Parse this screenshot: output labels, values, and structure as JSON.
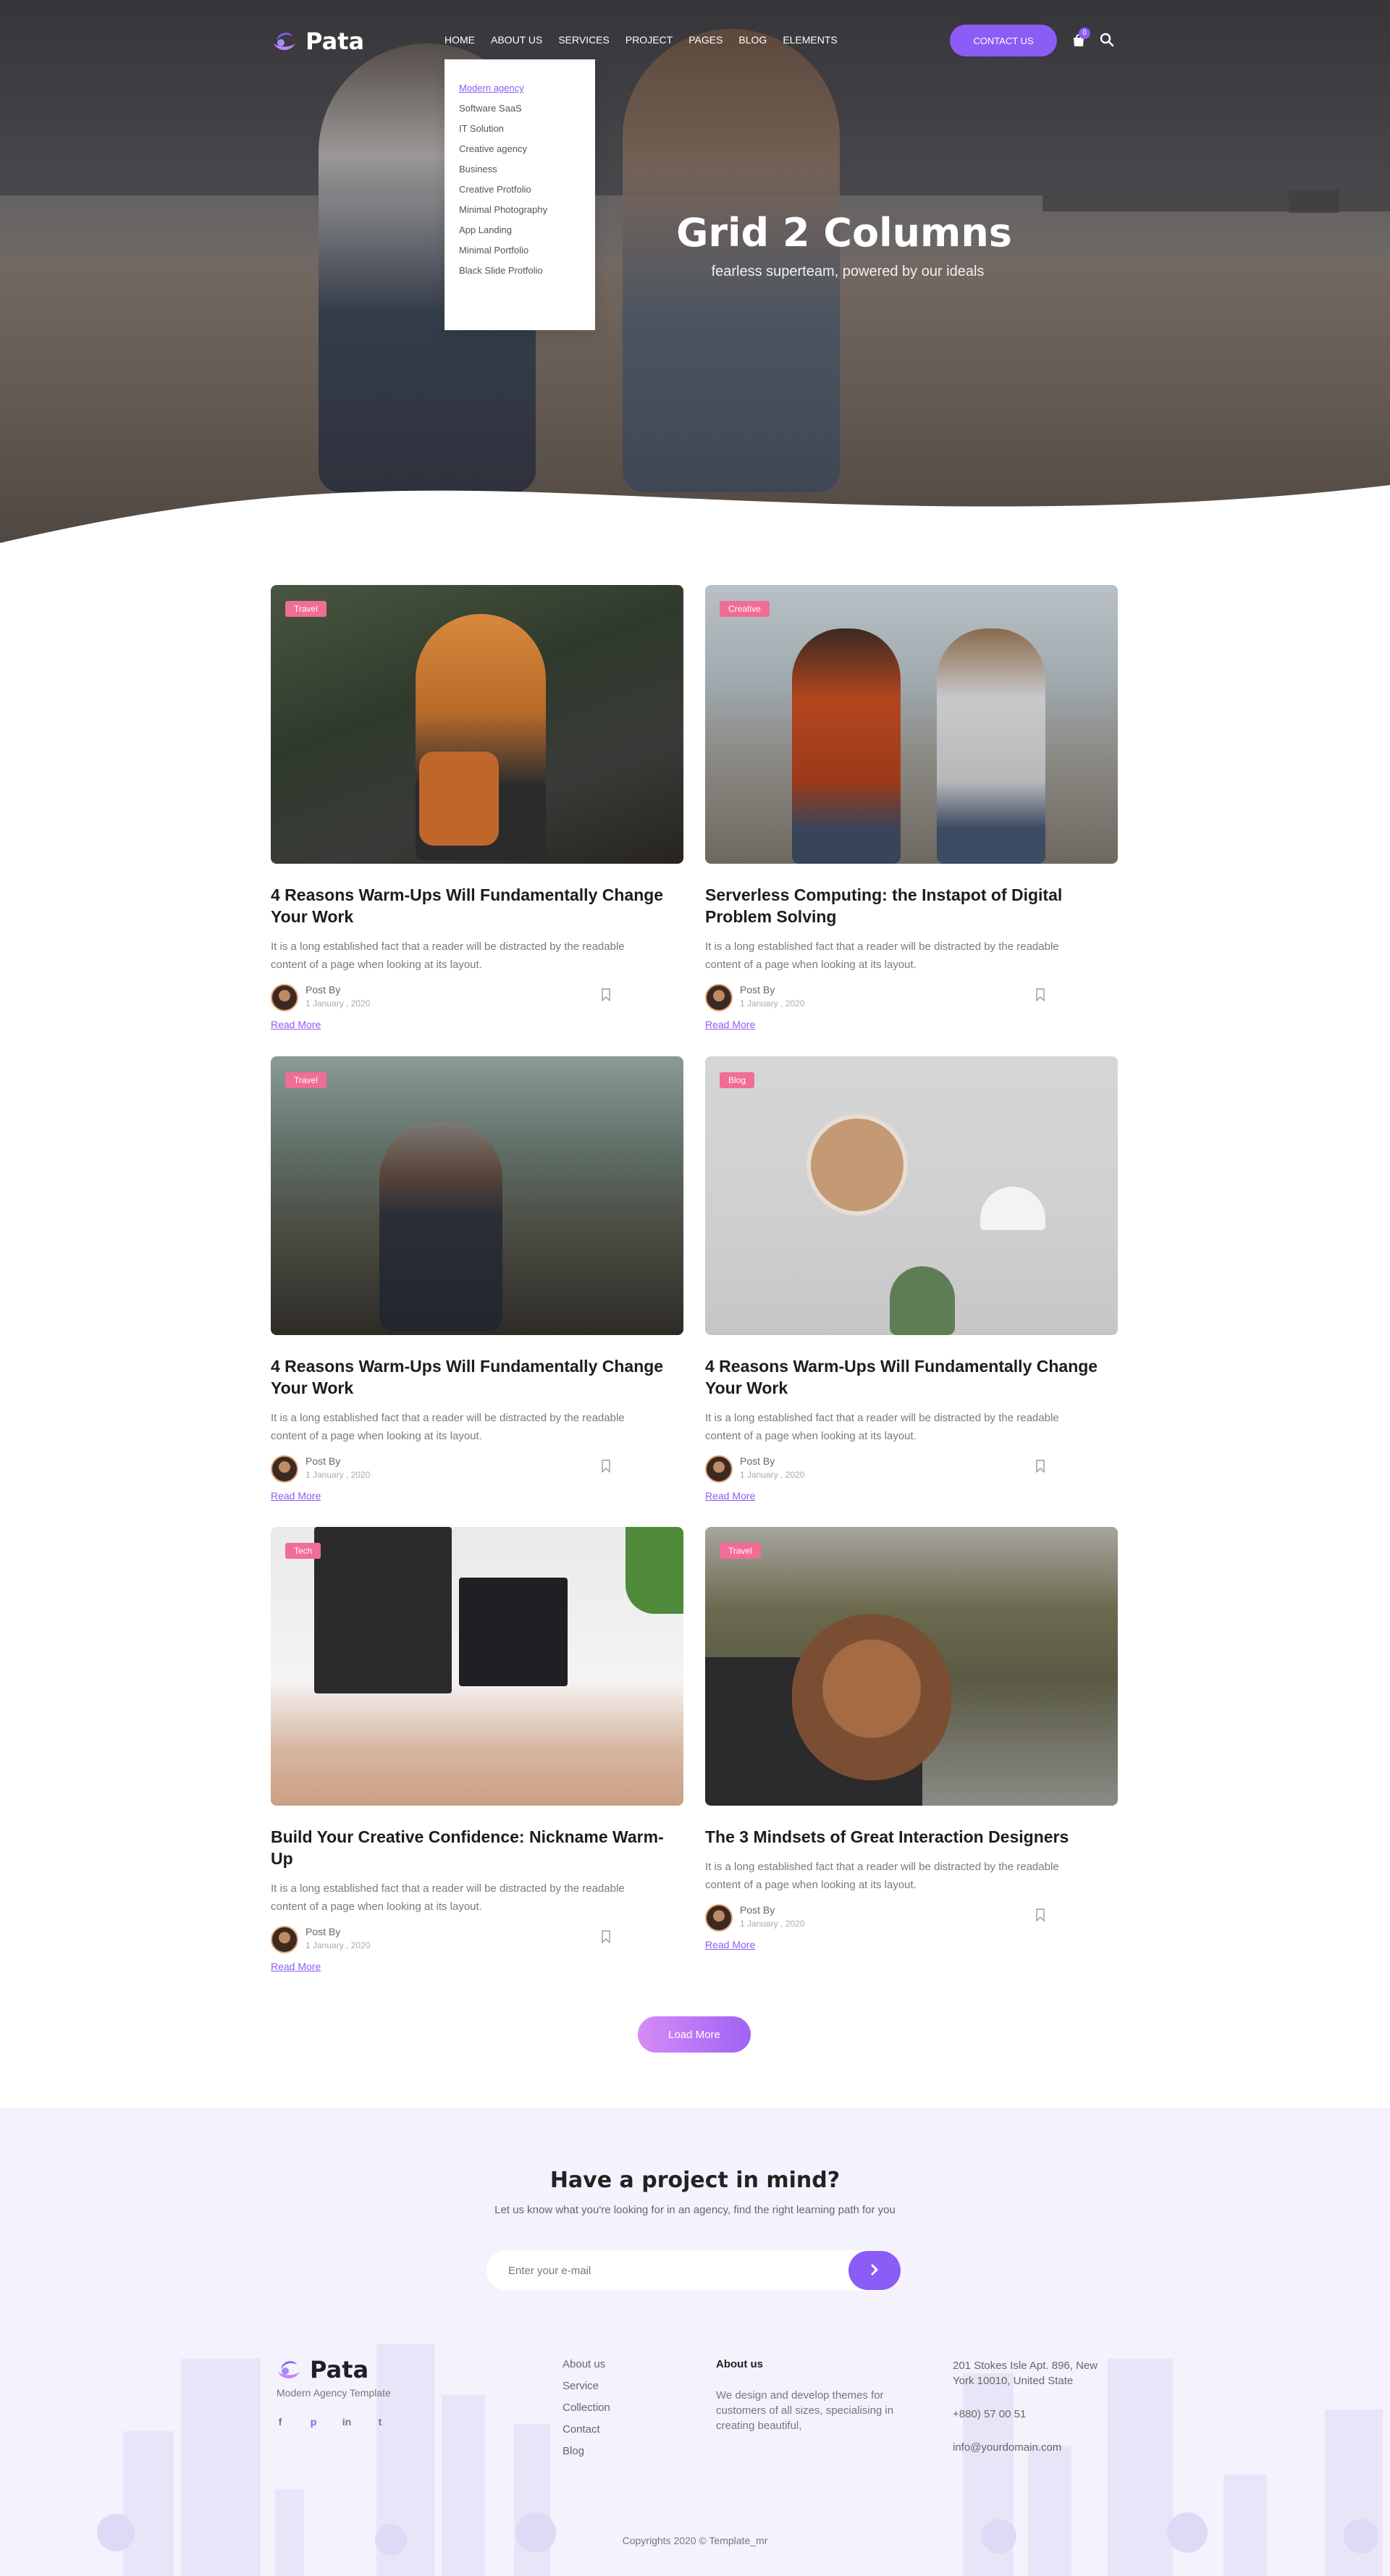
{
  "brand": {
    "name": "Pata",
    "accent": "#8b5cf6",
    "tag_color": "#f06d96"
  },
  "nav": {
    "items": [
      "HOME",
      "ABOUT US",
      "SERVICES",
      "PROJECT",
      "PAGES",
      "BLOG",
      "ELEMENTS"
    ],
    "contact_label": "CONTACT US",
    "cart_count": "0",
    "cart_icon": "shopping-bag-icon",
    "search_icon": "search-icon"
  },
  "dropdown": {
    "items": [
      "Modern agency",
      "Software SaaS",
      "IT Solution",
      "Creative agency",
      "Business",
      "Creative Protfolio",
      "Minimal Photography",
      "App Landing",
      "Minimal Portfolio",
      "Black Slide Protfolio"
    ],
    "active_index": 0
  },
  "hero": {
    "title": "Grid 2 Columns",
    "subtitle": "fearless superteam, powered by our ideals"
  },
  "posts": [
    {
      "tag": "Travel",
      "title": "4 Reasons Warm-Ups Will Fundamentally Change Your Work",
      "excerpt": "It is a long established fact that a reader will be distracted by the readable content of a page when looking at its layout.",
      "post_by": "Post By",
      "date": "1 January , 2020",
      "read_more": "Read More"
    },
    {
      "tag": "Creative",
      "title": "Serverless Computing: the Instapot of Digital Problem Solving",
      "excerpt": "It is a long established fact that a reader will be distracted by the readable content of a page when looking at its layout.",
      "post_by": "Post By",
      "date": "1 January , 2020",
      "read_more": "Read More"
    },
    {
      "tag": "Travel",
      "title": "4 Reasons Warm-Ups Will Fundamentally Change Your Work",
      "excerpt": "It is a long established fact that a reader will be distracted by the readable content of a page when looking at its layout.",
      "post_by": "Post By",
      "date": "1 January , 2020",
      "read_more": "Read More"
    },
    {
      "tag": "Blog",
      "title": "4 Reasons Warm-Ups Will Fundamentally Change Your Work",
      "excerpt": "It is a long established fact that a reader will be distracted by the readable content of a page when looking at its layout.",
      "post_by": "Post By",
      "date": "1 January , 2020",
      "read_more": "Read More"
    },
    {
      "tag": "Tech",
      "title": "Build Your Creative Confidence: Nickname Warm-Up",
      "excerpt": "It is a long established fact that a reader will be distracted by the readable content of a page when looking at its layout.",
      "post_by": "Post By",
      "date": "1 January , 2020",
      "read_more": "Read More"
    },
    {
      "tag": "Travel",
      "title": "The 3 Mindsets of Great Interaction Designers",
      "excerpt": "It is a long established fact that a reader will be distracted by the readable content of a page when looking at its layout.",
      "post_by": "Post By",
      "date": "1 January , 2020",
      "read_more": "Read More"
    }
  ],
  "load_more_label": "Load More",
  "cta": {
    "title": "Have a project in mind?",
    "subtitle": "Let us know what you're looking for in an agency, find the right learning path for you",
    "email_placeholder": "Enter your e-mail"
  },
  "footer": {
    "brand": "Pata",
    "tagline": "Modern Agency Template",
    "social": [
      "f",
      "p",
      "in",
      "t"
    ],
    "links": [
      "About us",
      "Service",
      "Collection",
      "Contact",
      "Blog"
    ],
    "about_heading": "About us",
    "about_text": "We design and develop themes for customers of all sizes, specialising in creating beautiful,",
    "address": "201 Stokes Isle Apt. 896, New York 10010, United State",
    "phone": "+880) 57 00 51",
    "email": "info@yourdomain.com",
    "copyright": "Copyrights 2020 © Template_mr"
  }
}
